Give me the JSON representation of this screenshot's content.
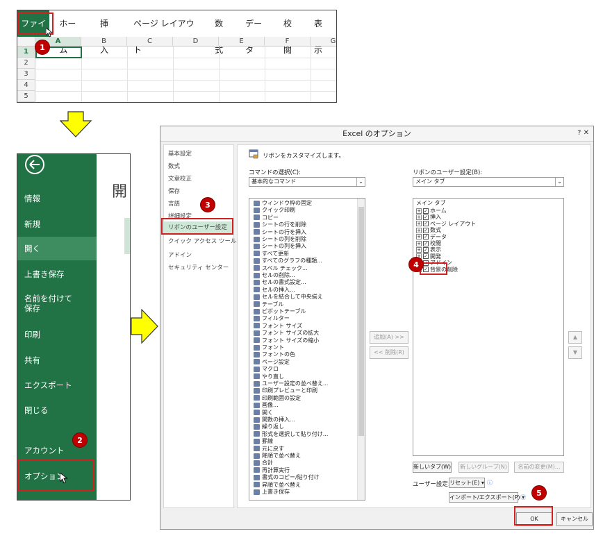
{
  "colors": {
    "excel_green": "#217346",
    "highlight": "#d02020",
    "badge": "#c00000",
    "arrow": "#ffff00"
  },
  "sheet": {
    "tabs": [
      "ファイル",
      "ホーム",
      "挿入",
      "ページ レイアウト",
      "数式",
      "データ",
      "校閲",
      "表示"
    ],
    "columns": [
      "A",
      "B",
      "C",
      "D",
      "E",
      "F",
      "G"
    ],
    "rows": [
      "1",
      "2",
      "3",
      "4",
      "5"
    ]
  },
  "backstage": {
    "back_icon": "back-arrow-icon",
    "heading_fragment": "開",
    "items": [
      "情報",
      "新規",
      "開く",
      "上書き保存",
      "名前を付けて\n保存",
      "印刷",
      "共有",
      "エクスポート",
      "閉じる",
      "アカウント",
      "オプション"
    ]
  },
  "dialog": {
    "title": "Excel のオプション",
    "title_buttons": "?  ✕",
    "nav": [
      "基本設定",
      "数式",
      "文章校正",
      "保存",
      "言語",
      "詳細設定",
      "リボンのユーザー設定",
      "クイック アクセス ツール バー",
      "アドイン",
      "セキュリティ センター"
    ],
    "header": "リボンをカスタマイズします。",
    "commands_label": "コマンドの選択(C):",
    "commands_value": "基本的なコマンド",
    "ribbon_label": "リボンのユーザー設定(B):",
    "ribbon_value": "メイン タブ",
    "commands": [
      "ウィンドウ枠の固定",
      "クイック印刷",
      "コピー",
      "シートの行を削除",
      "シートの行を挿入",
      "シートの列を削除",
      "シートの列を挿入",
      "すべて更新",
      "すべてのグラフの種類...",
      "スペル チェック...",
      "セルの削除...",
      "セルの書式設定...",
      "セルの挿入...",
      "セルを結合して中央揃え",
      "テーブル",
      "ピボットテーブル",
      "フィルター",
      "フォント サイズ",
      "フォント サイズの拡大",
      "フォント サイズの縮小",
      "フォント",
      "フォントの色",
      "ページ設定",
      "マクロ",
      "やり直し",
      "ユーザー設定の並べ替え...",
      "印刷プレビューと印刷",
      "印刷範囲の設定",
      "画像...",
      "開く",
      "関数の挿入...",
      "繰り返し",
      "形式を選択して貼り付け...",
      "罫線",
      "元に戻す",
      "降順で並べ替え",
      "合計",
      "再計算実行",
      "書式のコピー/貼り付け",
      "昇順で並べ替え",
      "上書き保存"
    ],
    "tree_header": "メイン タブ",
    "tree": [
      {
        "label": "ホーム",
        "checked": true
      },
      {
        "label": "挿入",
        "checked": true
      },
      {
        "label": "ページ レイアウト",
        "checked": true
      },
      {
        "label": "数式",
        "checked": true
      },
      {
        "label": "データ",
        "checked": true
      },
      {
        "label": "校閲",
        "checked": true
      },
      {
        "label": "表示",
        "checked": true
      },
      {
        "label": "開発",
        "checked": true
      },
      {
        "label": "アドイン",
        "checked": true
      },
      {
        "label": "背景の削除",
        "checked": true
      }
    ],
    "add_button": "追加(A) >>",
    "remove_button": "<< 削除(R)",
    "new_tab_button": "新しいタブ(W)",
    "new_group_button": "新しいグループ(N)",
    "rename_button": "名前の変更(M)...",
    "customize_label": "ユーザー設定:",
    "reset_button": "リセット(E) ▾",
    "import_export_button": "インポート/エクスポート(P) ▾",
    "ok_button": "OK",
    "cancel_button": "キャンセル"
  },
  "badges": [
    "1",
    "2",
    "3",
    "4",
    "5"
  ]
}
